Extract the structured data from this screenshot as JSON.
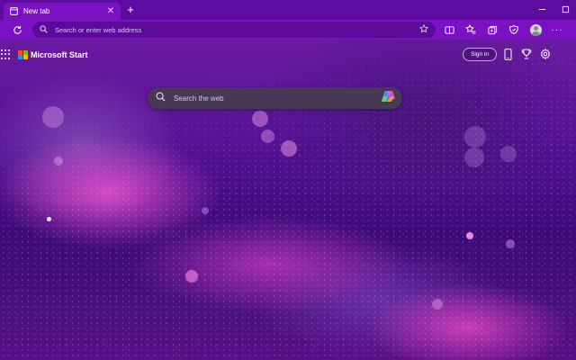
{
  "browser": {
    "tab": {
      "title": "New tab",
      "close_label": "✕"
    },
    "new_tab_label": "+",
    "address_bar": {
      "placeholder": "Search or enter web address"
    },
    "window_controls": {
      "minimize": "─",
      "maximize": "☐"
    },
    "more_label": "···",
    "icons": [
      "refresh-icon",
      "star-icon",
      "split-screen-icon",
      "favorites-icon",
      "collections-icon",
      "browser-essentials-icon",
      "profile-icon",
      "more-icon"
    ]
  },
  "start_page": {
    "brand": "Microsoft Start",
    "sign_in_label": "Sign in",
    "search": {
      "placeholder": "Search the web"
    },
    "icons": [
      "apps-grid-icon",
      "mobile-icon",
      "rewards-trophy-icon",
      "settings-gear-icon",
      "copilot-icon"
    ]
  },
  "colors": {
    "tabstrip": "#5d0ba0",
    "toolbar": "#7a12c4",
    "omnibox": "#5a0c98",
    "logo_red": "#f25022",
    "logo_green": "#7fba00",
    "logo_blue": "#00a4ef",
    "logo_yellow": "#ffb900"
  }
}
